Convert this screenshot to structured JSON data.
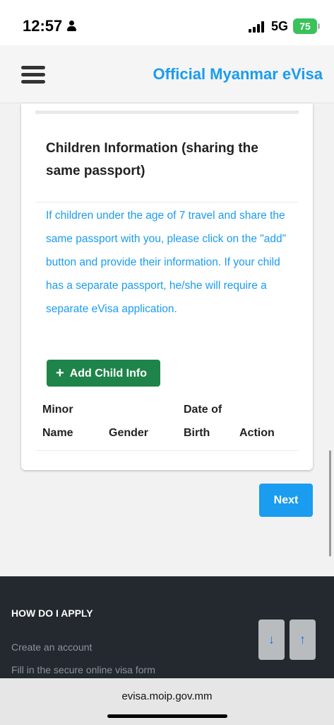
{
  "status_bar": {
    "time": "12:57",
    "network": "5G",
    "battery": "75",
    "battery_color": "#3ac25a"
  },
  "header": {
    "title": "Official Myanmar eVisa",
    "menu_icon": "hamburger-menu-icon",
    "accent_color": "#1a9cf0"
  },
  "children_section": {
    "title": "Children Information (sharing the same passport)",
    "info": "If children under the age of 7 travel and share the same passport with you, please click on the \"add\" button and provide their information. If your child has a separate passport, he/she will require a separate eVisa application.",
    "add_button_label": "Add Child Info",
    "add_button_color": "#1e8449",
    "table_headers": {
      "minor_name": "Minor Name",
      "gender": "Gender",
      "date_of_birth": "Date of Birth",
      "action": "Action"
    }
  },
  "next_button_label": "Next",
  "footer": {
    "heading": "HOW DO I APPLY",
    "links": [
      "Create an account",
      "Fill in the secure online visa form"
    ]
  },
  "browser": {
    "url": "evisa.moip.gov.mm"
  }
}
